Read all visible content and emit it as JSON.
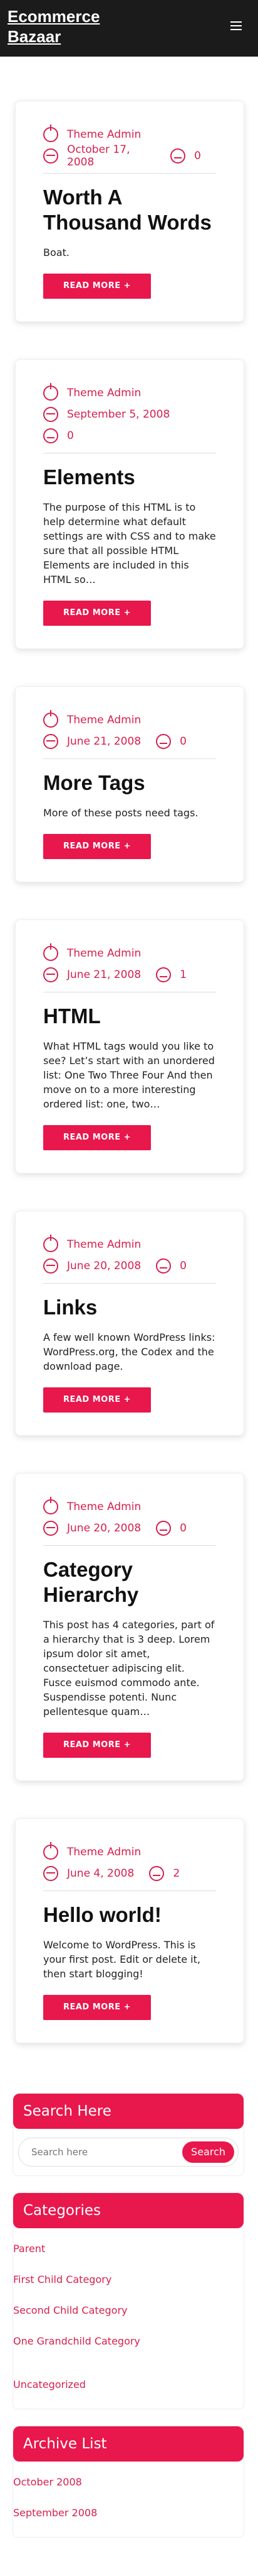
{
  "site": {
    "title": "Ecommerce Bazaar"
  },
  "posts": [
    {
      "author": "Theme Admin",
      "date": "October 17, 2008",
      "comments": "0",
      "title": "Worth A Thousand Words",
      "excerpt": "Boat.",
      "button": "READ MORE +"
    },
    {
      "author": "Theme Admin",
      "date": "September 5, 2008",
      "comments": "0",
      "title": "Elements",
      "excerpt": "The purpose of this HTML is to help determine what default settings are with CSS and to make sure that all possible HTML Elements are included in this HTML so…",
      "button": "READ MORE +"
    },
    {
      "author": "Theme Admin",
      "date": "June 21, 2008",
      "comments": "0",
      "title": "More Tags",
      "excerpt": "More of these posts need tags.",
      "button": "READ MORE +"
    },
    {
      "author": "Theme Admin",
      "date": "June 21, 2008",
      "comments": "1",
      "title": "HTML",
      "excerpt": "What HTML tags would you like to see? Let’s start with an unordered list: One Two Three Four And then move on to a more interesting ordered list: one, two…",
      "button": "READ MORE +"
    },
    {
      "author": "Theme Admin",
      "date": "June 20, 2008",
      "comments": "0",
      "title": "Links",
      "excerpt": "A few well known WordPress links: WordPress.org, the Codex and the download page.",
      "button": "READ MORE +"
    },
    {
      "author": "Theme Admin",
      "date": "June 20, 2008",
      "comments": "0",
      "title": "Category Hierarchy",
      "excerpt": "This post has 4 categories, part of a hierarchy that is 3 deep. Lorem ipsum dolor sit amet, consectetuer adipiscing elit. Fusce euismod commodo ante. Suspendisse potenti. Nunc pellentesque quam…",
      "button": "READ MORE +"
    },
    {
      "author": "Theme Admin",
      "date": "June 4, 2008",
      "comments": "2",
      "title": "Hello world!",
      "excerpt": "Welcome to WordPress. This is your first post. Edit or delete it, then start blogging!",
      "button": "READ MORE +"
    }
  ],
  "widgets": {
    "search": {
      "title": "Search Here",
      "placeholder": "Search here",
      "button": "Search"
    },
    "categories": {
      "title": "Categories",
      "items": [
        "Parent",
        "First Child Category",
        "Second Child Category",
        "One Grandchild Category",
        "Uncategorized"
      ]
    },
    "archive": {
      "title": "Archive List",
      "items": [
        "October 2008",
        "September 2008"
      ]
    }
  },
  "colors": {
    "accent": "#e8174c",
    "header": "#1b1b1b"
  },
  "icons": {
    "menu": "hamburger-menu-icon",
    "author": "user-icon",
    "date": "calendar-icon",
    "comments": "comment-icon"
  }
}
